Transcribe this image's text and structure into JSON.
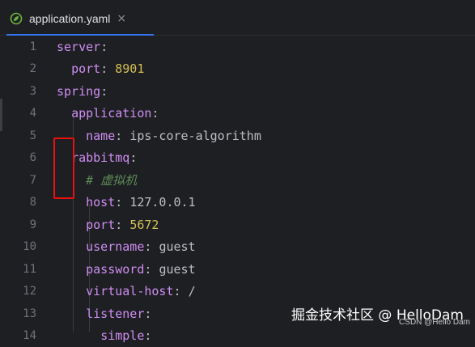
{
  "tab": {
    "title": "application.yaml",
    "close": "×",
    "accent": "#3574f0"
  },
  "lines": [
    {
      "n": "1",
      "indent": "",
      "key": "server",
      "sep": ":",
      "value": "",
      "vtype": ""
    },
    {
      "n": "2",
      "indent": "  ",
      "key": "port",
      "sep": ": ",
      "value": "8901",
      "vtype": "num"
    },
    {
      "n": "3",
      "indent": "",
      "key": "spring",
      "sep": ":",
      "value": "",
      "vtype": ""
    },
    {
      "n": "4",
      "indent": "  ",
      "key": "application",
      "sep": ":",
      "value": "",
      "vtype": ""
    },
    {
      "n": "5",
      "indent": "    ",
      "key": "name",
      "sep": ": ",
      "value": "ips-core-algorithm",
      "vtype": "str"
    },
    {
      "n": "6",
      "indent": "  ",
      "key": "rabbitmq",
      "sep": ":",
      "value": "",
      "vtype": ""
    },
    {
      "n": "7",
      "indent": "    ",
      "key": "",
      "sep": "",
      "value": "# 虚拟机",
      "vtype": "cmt"
    },
    {
      "n": "8",
      "indent": "    ",
      "key": "host",
      "sep": ": ",
      "value": "127.0.0.1",
      "vtype": "str"
    },
    {
      "n": "9",
      "indent": "    ",
      "key": "port",
      "sep": ": ",
      "value": "5672",
      "vtype": "num"
    },
    {
      "n": "10",
      "indent": "    ",
      "key": "username",
      "sep": ": ",
      "value": "guest",
      "vtype": "str"
    },
    {
      "n": "11",
      "indent": "    ",
      "key": "password",
      "sep": ": ",
      "value": "guest",
      "vtype": "str"
    },
    {
      "n": "12",
      "indent": "    ",
      "key": "virtual-host",
      "sep": ": ",
      "value": "/",
      "vtype": "str"
    },
    {
      "n": "13",
      "indent": "    ",
      "key": "listener",
      "sep": ":",
      "value": "",
      "vtype": ""
    },
    {
      "n": "14",
      "indent": "      ",
      "key": "simple",
      "sep": ":",
      "value": "",
      "vtype": ""
    }
  ],
  "watermark": "掘金技术社区 @ HelloDam",
  "csdn_mark": "CSDN @Hello Dam",
  "colors": {
    "key": "#cf8ef4",
    "number": "#d6bf55",
    "comment": "#5f8c5a",
    "annotation": "#e81010"
  }
}
